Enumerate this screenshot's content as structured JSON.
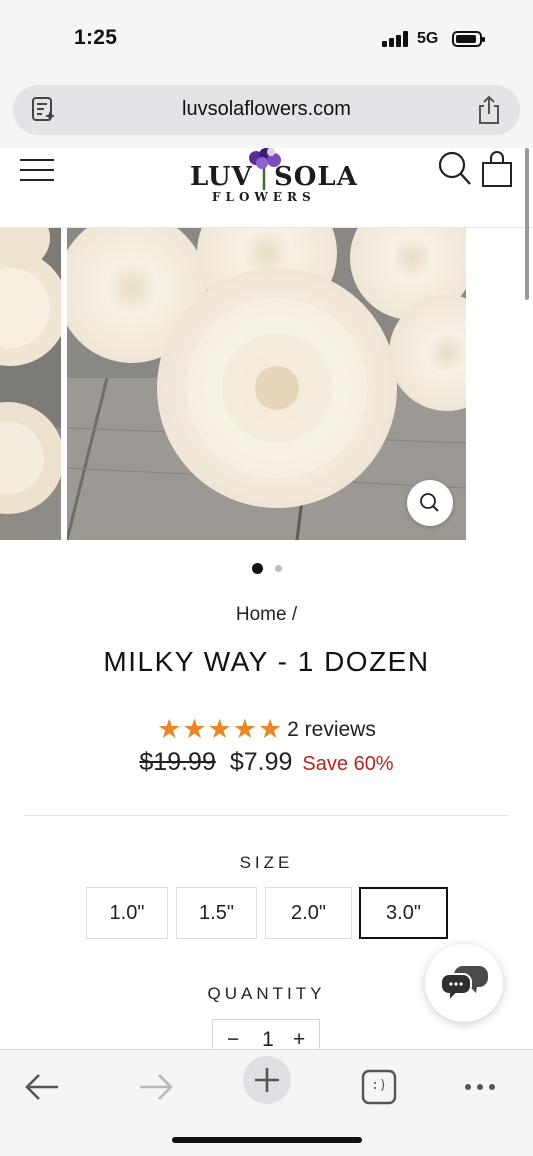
{
  "status_bar": {
    "time": "1:25",
    "network": "5G"
  },
  "browser": {
    "url": "luvsolaflowers.com"
  },
  "site": {
    "logo_left": "LUV",
    "logo_right": "SOLA",
    "logo_sub": "FLOWERS"
  },
  "product": {
    "breadcrumb": "Home /",
    "title": "MILKY WAY - 1 DOZEN",
    "stars": "★★★★★",
    "rating_value": 5,
    "reviews": "2 reviews",
    "price_old": "$19.99",
    "price_new": "$7.99",
    "save": "Save 60%",
    "size_label": "SIZE",
    "sizes": [
      "1.0\"",
      "1.5\"",
      "2.0\"",
      "3.0\""
    ],
    "selected_size": "3.0\"",
    "quantity_label": "QUANTITY",
    "quantity": "1",
    "qty_minus": "−",
    "qty_plus": "+"
  },
  "gallery": {
    "image_count": 2,
    "active_index": 0
  },
  "colors": {
    "star": "#e8862a",
    "save": "#b3261e",
    "accent": "#111111"
  },
  "toolbar": {
    "buttons": [
      "back-arrow-icon",
      "forward-arrow-icon",
      "new-tab-plus-icon",
      "tabs-icon",
      "more-icon"
    ],
    "tabs_glyph": ":)"
  }
}
